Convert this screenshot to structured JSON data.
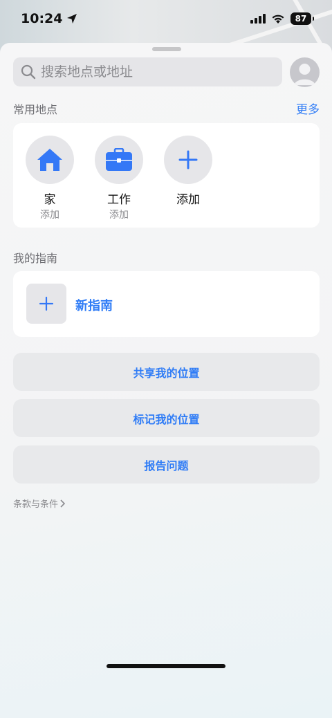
{
  "status": {
    "time": "10:24",
    "battery": "87"
  },
  "search": {
    "placeholder": "搜索地点或地址"
  },
  "favorites": {
    "header": "常用地点",
    "more": "更多",
    "items": [
      {
        "title": "家",
        "subtitle": "添加",
        "icon": "house-icon"
      },
      {
        "title": "工作",
        "subtitle": "添加",
        "icon": "briefcase-icon"
      },
      {
        "title": "添加",
        "subtitle": "",
        "icon": "plus-icon"
      }
    ]
  },
  "guides": {
    "header": "我的指南",
    "new_label": "新指南"
  },
  "actions": {
    "share": "共享我的位置",
    "mark": "标记我的位置",
    "report": "报告问题"
  },
  "terms": "条款与条件",
  "colors": {
    "accent": "#2f7cf6",
    "icon_blue": "#3478f6"
  }
}
